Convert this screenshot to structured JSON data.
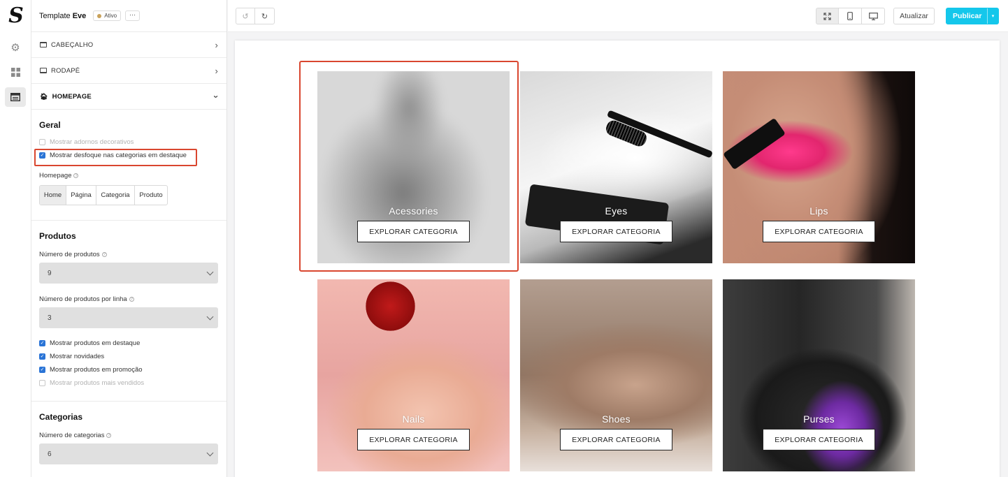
{
  "app": {
    "template_name_prefix": "Template",
    "template_name": "Eve",
    "status_badge": "Ativo",
    "more_label": "···"
  },
  "sections": {
    "header": "CABEÇALHO",
    "footer": "RODAPÉ",
    "homepage": "HOMEPAGE"
  },
  "geral": {
    "title": "Geral",
    "options": [
      {
        "label": "Mostrar adornos decorativos",
        "checked": false
      },
      {
        "label": "Mostrar desfoque nas categorias em destaque",
        "checked": true
      }
    ],
    "homepage_label": "Homepage",
    "homepage_tabs": [
      "Home",
      "Página",
      "Categoria",
      "Produto"
    ],
    "homepage_selected": "Home"
  },
  "produtos": {
    "title": "Produtos",
    "num_label": "Número de produtos",
    "num_value": "9",
    "per_line_label": "Número de produtos por linha",
    "per_line_value": "3",
    "options": [
      {
        "label": "Mostrar produtos em destaque",
        "checked": true
      },
      {
        "label": "Mostrar novidades",
        "checked": true
      },
      {
        "label": "Mostrar produtos em promoção",
        "checked": true
      },
      {
        "label": "Mostrar produtos mais vendidos",
        "checked": false
      }
    ]
  },
  "categorias": {
    "title": "Categorias",
    "num_label": "Número de categorias",
    "num_value": "6"
  },
  "toolbar": {
    "atualizar": "Atualizar",
    "publicar": "Publicar",
    "devices": [
      "fullscreen-icon",
      "mobile-icon",
      "desktop-icon"
    ]
  },
  "preview": {
    "cta_label": "EXPLORAR CATEGORIA",
    "categories": [
      {
        "name": "Acessories"
      },
      {
        "name": "Eyes"
      },
      {
        "name": "Lips"
      },
      {
        "name": "Nails"
      },
      {
        "name": "Shoes"
      },
      {
        "name": "Purses"
      }
    ]
  },
  "colors": {
    "accent": "#14c7eb",
    "highlight": "#d9462f",
    "checkbox": "#2a74d6"
  }
}
